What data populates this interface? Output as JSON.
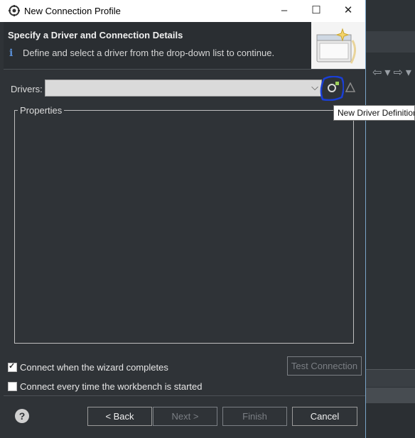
{
  "window": {
    "title": "New Connection Profile",
    "minimize": "–",
    "maximize": "☐",
    "close": "✕"
  },
  "header": {
    "heading": "Specify a Driver and Connection Details",
    "info_icon": "i",
    "description": "Define and select a driver from the drop-down list to continue."
  },
  "drivers": {
    "label": "Drivers:",
    "value": "",
    "chevron": "⌵"
  },
  "tooltip": {
    "text": "New Driver Definition"
  },
  "properties": {
    "legend": "Properties"
  },
  "options": {
    "connect_when_completes": "Connect when the wizard completes",
    "connect_when_completes_checked": true,
    "connect_every_time": "Connect every time the workbench is started",
    "connect_every_time_checked": false
  },
  "buttons": {
    "test_connection": "Test Connection",
    "back": "< Back",
    "next": "Next >",
    "finish": "Finish",
    "cancel": "Cancel",
    "help": "?"
  },
  "colors": {
    "dialog_bg": "#2f3337",
    "titlebar_bg": "#ffffff",
    "highlight_circle": "#1a3fd6",
    "info_blue": "#5a8fd6"
  }
}
